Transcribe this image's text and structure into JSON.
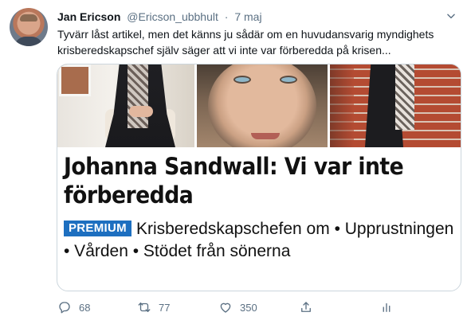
{
  "tweet": {
    "author_name": "Jan Ericson",
    "author_handle": "@Ericson_ubbhult",
    "separator": "·",
    "date": "7 maj",
    "text": "Tyvärr låst artikel, men det känns ju sådär om en huvudansvarig myndighets krisberedskapschef själv säger att vi inte var förberedda på krisen..."
  },
  "card": {
    "headline": "Johanna Sandwall: Vi var inte förberedda",
    "badge": "PREMIUM",
    "description": "Krisberedskapschefen om • Upprustningen • Vården • Stödet från sönerna"
  },
  "actions": {
    "replies": "68",
    "retweets": "77",
    "likes": "350"
  },
  "icons": {
    "reply": "reply-icon",
    "retweet": "retweet-icon",
    "like": "heart-icon",
    "share": "share-icon",
    "analytics": "analytics-icon",
    "menu": "chevron-down-icon"
  },
  "colors": {
    "secondary_text": "#5b7083",
    "premium_badge": "#1d6fc0",
    "card_border": "#ccd6dd"
  }
}
